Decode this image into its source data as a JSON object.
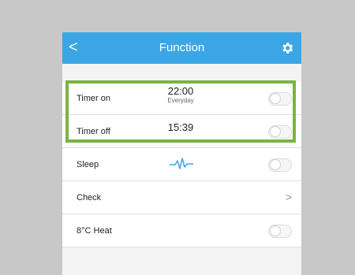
{
  "header": {
    "back_icon": "chevron-left-icon",
    "back_glyph": "<",
    "title": "Function",
    "settings_icon": "gear-icon",
    "color": "#3aa6e6"
  },
  "rows": [
    {
      "label": "Timer on",
      "time": "22:00",
      "repeat": "Everyday",
      "toggle_on": false
    },
    {
      "label": "Timer off",
      "time": "15:39",
      "toggle_on": false
    },
    {
      "label": "Sleep",
      "icon": "heartbeat-wave-icon",
      "icon_color": "#3aa6e6",
      "toggle_on": false
    },
    {
      "label": "Check",
      "chevron_icon": "chevron-right-icon",
      "chevron_glyph": ">"
    },
    {
      "label": "8°C Heat",
      "toggle_on": false
    }
  ],
  "highlight_color": "#7cb342"
}
